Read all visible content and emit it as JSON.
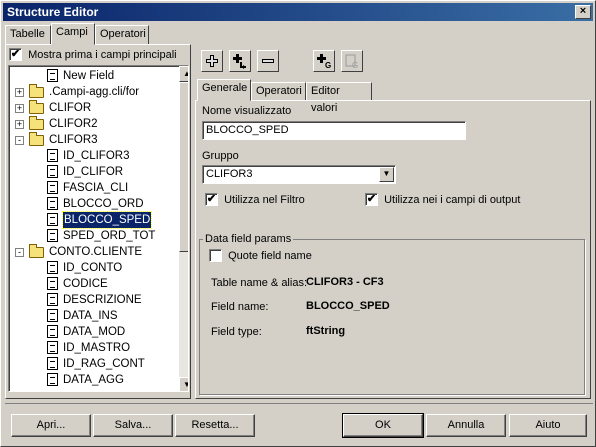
{
  "window": {
    "title": "Structure Editor",
    "close_glyph": "×"
  },
  "top_tabs": [
    {
      "label": "Tabelle",
      "active": false
    },
    {
      "label": "Campi",
      "active": true
    },
    {
      "label": "Operatori",
      "active": false
    }
  ],
  "show_main_fields": {
    "label": "Mostra prima i campi principali",
    "checked": true
  },
  "tree": {
    "rows": [
      {
        "label": "New Field",
        "kind": "field",
        "indent": 2
      },
      {
        "label": ".Campi-agg.cli/for",
        "kind": "folder",
        "indent": 0,
        "expander": "+"
      },
      {
        "label": "CLIFOR",
        "kind": "folder",
        "indent": 0,
        "expander": "+"
      },
      {
        "label": "CLIFOR2",
        "kind": "folder",
        "indent": 0,
        "expander": "+"
      },
      {
        "label": "CLIFOR3",
        "kind": "folder",
        "indent": 0,
        "expander": "-"
      },
      {
        "label": "ID_CLIFOR3",
        "kind": "field",
        "indent": 1
      },
      {
        "label": "ID_CLIFOR",
        "kind": "field",
        "indent": 1
      },
      {
        "label": "FASCIA_CLI",
        "kind": "field",
        "indent": 1
      },
      {
        "label": "BLOCCO_ORD",
        "kind": "field",
        "indent": 1
      },
      {
        "label": "BLOCCO_SPED",
        "kind": "field",
        "indent": 1,
        "selected": true
      },
      {
        "label": "SPED_ORD_TOT",
        "kind": "field",
        "indent": 1
      },
      {
        "label": "CONTO.CLIENTE",
        "kind": "folder",
        "indent": 0,
        "expander": "-"
      },
      {
        "label": "ID_CONTO",
        "kind": "field",
        "indent": 1
      },
      {
        "label": "CODICE",
        "kind": "field",
        "indent": 1
      },
      {
        "label": "DESCRIZIONE",
        "kind": "field",
        "indent": 1
      },
      {
        "label": "DATA_INS",
        "kind": "field",
        "indent": 1
      },
      {
        "label": "DATA_MOD",
        "kind": "field",
        "indent": 1
      },
      {
        "label": "ID_MASTRO",
        "kind": "field",
        "indent": 1
      },
      {
        "label": "ID_RAG_CONT",
        "kind": "field",
        "indent": 1
      },
      {
        "label": "DATA_AGG",
        "kind": "field",
        "indent": 1
      }
    ],
    "scroll_up": "▲",
    "scroll_down": "▼"
  },
  "toolbar": {
    "buttons": [
      {
        "name": "add-field-button",
        "icon": "plus-icon"
      },
      {
        "name": "add-child-button",
        "icon": "plus-child-icon"
      },
      {
        "name": "remove-field-button",
        "icon": "minus-icon"
      },
      {
        "name": "add-group-button",
        "icon": "plus-group-icon"
      },
      {
        "name": "group-disabled-button",
        "icon": "group-disabled-icon"
      }
    ]
  },
  "detail_tabs": [
    {
      "label": "Generale",
      "active": true
    },
    {
      "label": "Operatori",
      "active": false
    },
    {
      "label": "Editor valori",
      "active": false
    }
  ],
  "general": {
    "display_name_label": "Nome visualizzato",
    "display_name_value": "BLOCCO_SPED",
    "group_label": "Gruppo",
    "group_value": "CLIFOR3",
    "combo_arrow": "▼",
    "use_in_filter": {
      "label": "Utilizza nel Filtro",
      "checked": true
    },
    "use_in_output": {
      "label": "Utilizza nei i campi di output",
      "checked": true
    }
  },
  "data_field_params": {
    "title": "Data field params",
    "quote_field_name": {
      "label": "Quote field name",
      "checked": false
    },
    "table_alias_label": "Table name & alias:",
    "table_alias_value": "CLIFOR3 - CF3",
    "field_name_label": "Field name:",
    "field_name_value": "BLOCCO_SPED",
    "field_type_label": "Field type:",
    "field_type_value": "ftString"
  },
  "footer": {
    "open": "Apri...",
    "save": "Salva...",
    "reset": "Resetta...",
    "ok": "OK",
    "cancel": "Annulla",
    "help": "Aiuto"
  },
  "check_glyph": "✔"
}
